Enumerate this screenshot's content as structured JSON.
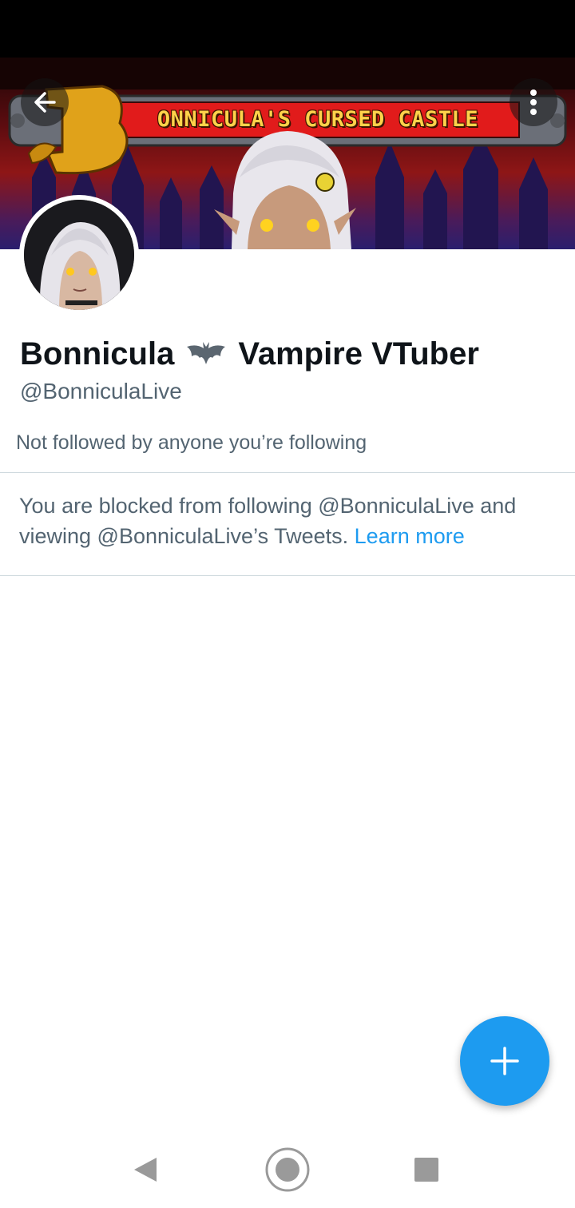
{
  "banner": {
    "title": "ONNICULA'S CURSED CASTLE",
    "initial": "B"
  },
  "profile": {
    "name_before": "Bonnicula",
    "name_emoji": "bat",
    "name_after": "Vampire VTuber",
    "handle": "@BonniculaLive",
    "followed_by": "Not followed by anyone you’re following"
  },
  "blocked_notice": {
    "text": "You are blocked from following @BonniculaLive and viewing @BonniculaLive’s Tweets.",
    "link": "Learn more"
  },
  "colors": {
    "accent": "#1d9bf0",
    "secondary_text": "#536471",
    "divider": "#cfd9de"
  },
  "icons": {
    "back": "arrow-left-icon",
    "more": "more-vertical-icon",
    "compose": "plus-icon",
    "nav_back": "triangle-back-icon",
    "nav_home": "circle-home-icon",
    "nav_recents": "square-recents-icon"
  }
}
